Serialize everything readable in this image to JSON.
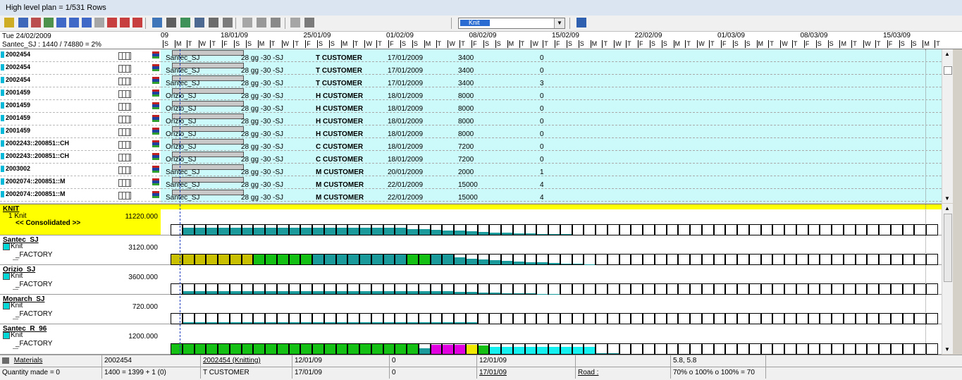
{
  "window": {
    "title": "High level plan  = 1/531 Rows"
  },
  "toolbar": {
    "combo_value": "Knit"
  },
  "header": {
    "date_label": "Tue 24/02/2009",
    "capacity_label": "Santec_SJ : 1440 / 74880 = 2%",
    "weeks": [
      "09",
      "18/01/09",
      "25/01/09",
      "01/02/09",
      "08/02/09",
      "15/02/09",
      "22/02/09",
      "01/03/09",
      "08/03/09",
      "15/03/09"
    ],
    "day_letters": [
      "S",
      "M",
      "T",
      "W",
      "T",
      "F",
      "S",
      "S",
      "M",
      "T",
      "W",
      "T",
      "F",
      "S",
      "S",
      "M",
      "T",
      "W",
      "T",
      "F",
      "S",
      "S",
      "M",
      "T",
      "W",
      "T",
      "F",
      "S",
      "S",
      "M",
      "T",
      "W",
      "T",
      "F",
      "S",
      "S",
      "M",
      "T",
      "W",
      "T",
      "F",
      "S",
      "S",
      "M",
      "T",
      "W",
      "T",
      "F",
      "S",
      "S",
      "M",
      "T",
      "W",
      "T",
      "F",
      "S",
      "S",
      "M",
      "T",
      "W",
      "T",
      "F",
      "S",
      "S",
      "M",
      "T"
    ]
  },
  "orders": [
    {
      "code": "2002454",
      "factory": "Santec_SJ",
      "days": "28 gg -30 -SJ",
      "customer": "T CUSTOMER",
      "date": "17/01/2009",
      "qty": "3400",
      "n": "0"
    },
    {
      "code": "2002454",
      "factory": "Santec_SJ",
      "days": "28 gg -30 -SJ",
      "customer": "T CUSTOMER",
      "date": "17/01/2009",
      "qty": "3400",
      "n": "0"
    },
    {
      "code": "2002454",
      "factory": "Santec_SJ",
      "days": "28 gg -30 -SJ",
      "customer": "T CUSTOMER",
      "date": "17/01/2009",
      "qty": "3400",
      "n": "3"
    },
    {
      "code": "2001459",
      "factory": "Orizio_SJ",
      "days": "28 gg -30 -SJ",
      "customer": "H CUSTOMER",
      "date": "18/01/2009",
      "qty": "8000",
      "n": "0"
    },
    {
      "code": "2001459",
      "factory": "Orizio_SJ",
      "days": "28 gg -30 -SJ",
      "customer": "H CUSTOMER",
      "date": "18/01/2009",
      "qty": "8000",
      "n": "0"
    },
    {
      "code": "2001459",
      "factory": "Orizio_SJ",
      "days": "28 gg -30 -SJ",
      "customer": "H CUSTOMER",
      "date": "18/01/2009",
      "qty": "8000",
      "n": "0"
    },
    {
      "code": "2001459",
      "factory": "Orizio_SJ",
      "days": "28 gg -30 -SJ",
      "customer": "H CUSTOMER",
      "date": "18/01/2009",
      "qty": "8000",
      "n": "0"
    },
    {
      "code": "2002243::200851::CH",
      "factory": "Orizio_SJ",
      "days": "28 gg -30 -SJ",
      "customer": "C CUSTOMER",
      "date": "18/01/2009",
      "qty": "7200",
      "n": "0"
    },
    {
      "code": "2002243::200851::CH",
      "factory": "Orizio_SJ",
      "days": "28 gg -30 -SJ",
      "customer": "C CUSTOMER",
      "date": "18/01/2009",
      "qty": "7200",
      "n": "0"
    },
    {
      "code": "2003002",
      "factory": "Santec_SJ",
      "days": "28 gg -30 -SJ",
      "customer": "M CUSTOMER",
      "date": "20/01/2009",
      "qty": "2000",
      "n": "1"
    },
    {
      "code": "2002074::200851::M",
      "factory": "Santec_SJ",
      "days": "28 gg -30 -SJ",
      "customer": "M CUSTOMER",
      "date": "22/01/2009",
      "qty": "15000",
      "n": "4"
    },
    {
      "code": "2002074::200851::M",
      "factory": "Santec_SJ",
      "days": "28 gg -30 -SJ",
      "customer": "M CUSTOMER",
      "date": "22/01/2009",
      "qty": "15000",
      "n": "4"
    }
  ],
  "capacity": [
    {
      "name": "KNIT",
      "sub": "1 Knit",
      "extra": "<< Consolidated >>",
      "value": "11220.000"
    },
    {
      "name": "Santec_SJ",
      "sub": "Knit",
      "extra": "_FACTORY",
      "value": "3120.000"
    },
    {
      "name": "Orizio_SJ",
      "sub": "Knit",
      "extra": "_FACTORY",
      "value": "3600.000"
    },
    {
      "name": "Monarch_SJ",
      "sub": "Knit",
      "extra": "_FACTORY",
      "value": "720.000"
    },
    {
      "name": "Santec_R_96",
      "sub": "Knit",
      "extra": "_FACTORY",
      "value": "1200.000"
    }
  ],
  "status": {
    "row1": {
      "materials": "Materials",
      "order": "2002454",
      "link": "2002454 (Knitting)",
      "date1": "12/01/09",
      "zero": "0",
      "date2": "12/01/09",
      "vals": "5.8, 5.8"
    },
    "row2": {
      "qty": "Quantity made = 0",
      "calc": "1400 = 1399 + 1  (0)",
      "customer": "T CUSTOMER",
      "date1": "17/01/09",
      "zero": "0",
      "date2": "17/01/09",
      "road": "Road :",
      "pct": "70% o 100% o 100% = 70"
    }
  }
}
